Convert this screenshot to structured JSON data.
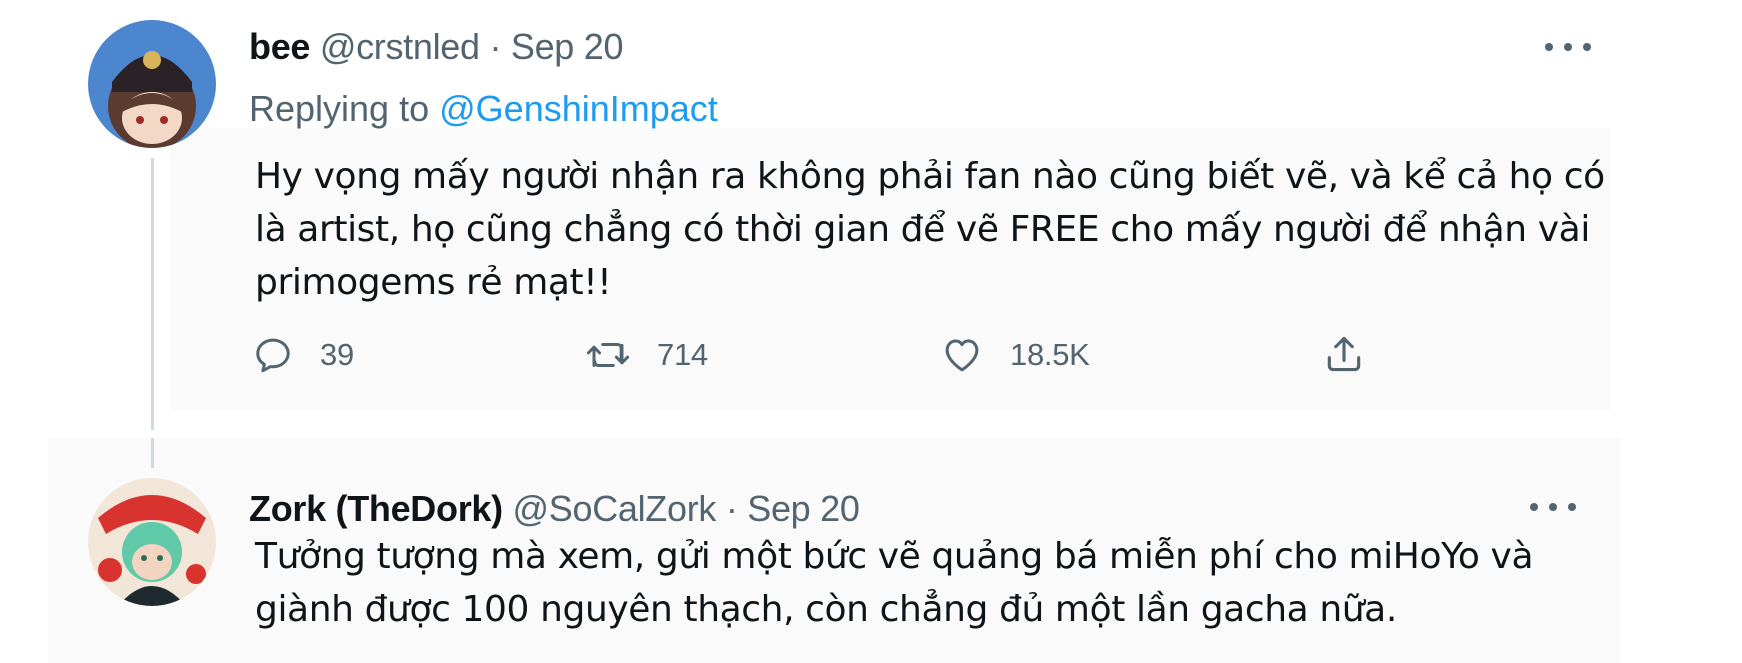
{
  "tweet": {
    "display_name": "bee",
    "handle": "@crstnled",
    "separator": "·",
    "date": "Sep 20",
    "replying_prefix": "Replying to",
    "replying_to": "@GenshinImpact",
    "text": "Hy vọng mấy người nhận ra không phải fan nào cũng biết vẽ, và kể cả họ có là artist, họ cũng chẳng có thời gian để vẽ FREE cho mấy người để nhận vài primogems rẻ mạt!!",
    "actions": {
      "reply_count": "39",
      "retweet_count": "714",
      "like_count": "18.5K"
    },
    "icons": [
      "reply-icon",
      "retweet-icon",
      "like-icon",
      "share-icon",
      "more-icon"
    ]
  },
  "reply": {
    "display_name": "Zork (TheDork)",
    "handle": "@SoCalZork",
    "separator": "·",
    "date": "Sep 20",
    "text": "Tưởng tượng mà xem, gửi một bức vẽ quảng bá miễn phí cho miHoYo và giành được 100 nguyên thạch, còn chẳng đủ một lần gacha nữa."
  },
  "colors": {
    "text_primary": "#0f1419",
    "text_secondary": "#536471",
    "link": "#1d9bf0",
    "thread_line": "#cfd9de"
  }
}
